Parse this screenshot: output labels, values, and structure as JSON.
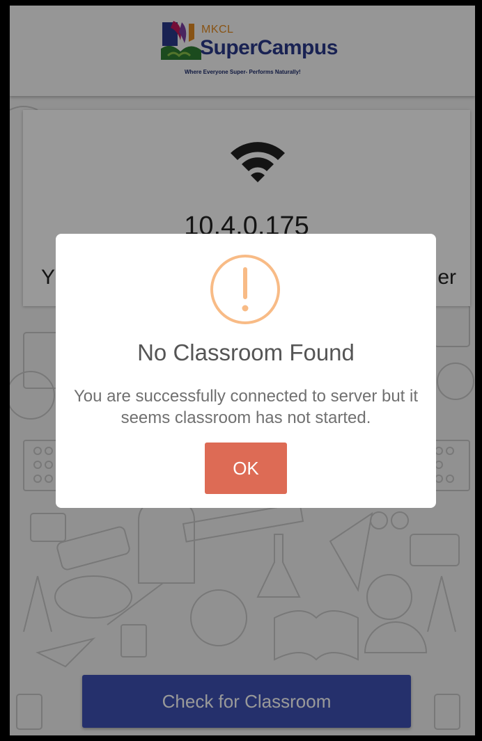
{
  "header": {
    "logo_brand": "MKCL",
    "logo_name": "SuperCampus",
    "logo_tagline": "Where Everyone Super- Performs Naturally!"
  },
  "connection_card": {
    "icon": "wifi-icon",
    "ip_address": "10.4.0.175",
    "subtext_left": "Y",
    "subtext_right": "er"
  },
  "main": {
    "check_button_label": "Check for Classroom"
  },
  "dialog": {
    "icon": "warning-icon",
    "title": "No Classroom Found",
    "message": "You are successfully connected to server but it seems classroom has not started.",
    "ok_label": "OK"
  },
  "colors": {
    "primary": "#3f51b5",
    "confirm": "#dd6b55",
    "warning": "#f8bb86"
  }
}
